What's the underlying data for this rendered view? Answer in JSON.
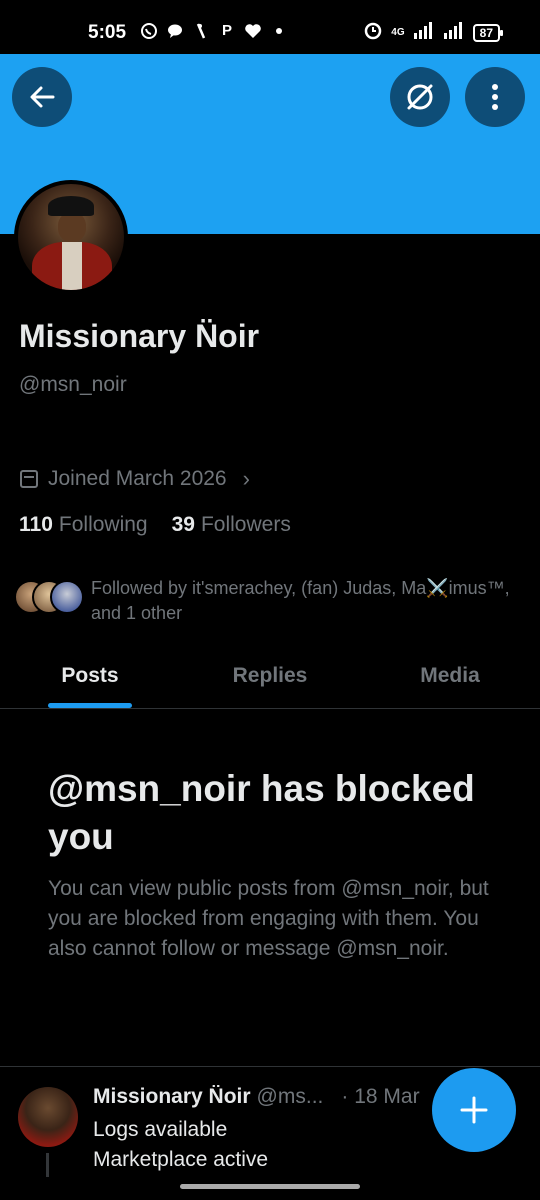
{
  "status_bar": {
    "time": "5:05",
    "network": "4G",
    "battery": "87",
    "notif_icons": [
      "whatsapp-icon",
      "chat-icon",
      "app-icon",
      "p-icon",
      "heart-icon",
      "dot-icon"
    ]
  },
  "header": {
    "back_icon": "arrow-left-icon",
    "grok_icon": "grok-icon",
    "more_icon": "more-vertical-icon",
    "banner_color": "#1da1f2"
  },
  "profile": {
    "name": "Missionary N̈oir",
    "handle": "@msn_noir",
    "joined": "Joined March 2026",
    "following_count": "110",
    "following_label": "Following",
    "followers_count": "39",
    "followers_label": "Followers",
    "followed_by": "Followed by it'smerachey, (fan) Judas, Ma⚔️imus™, and 1 other"
  },
  "tabs": [
    {
      "label": "Posts",
      "active": true
    },
    {
      "label": "Replies",
      "active": false
    },
    {
      "label": "Media",
      "active": false
    }
  ],
  "blocked": {
    "title": "@msn_noir has blocked you",
    "body": "You can view public posts from @msn_noir, but you are blocked from engaging with them. You also cannot follow or message @msn_noir."
  },
  "post": {
    "name": "Missionary N̈oir",
    "handle": "@ms...",
    "date": "· 18 Mar",
    "line1": "Logs available",
    "line2": "Marketplace active"
  },
  "colors": {
    "accent": "#1d9bf0",
    "muted": "#71767b",
    "text": "#e7e9ea"
  }
}
